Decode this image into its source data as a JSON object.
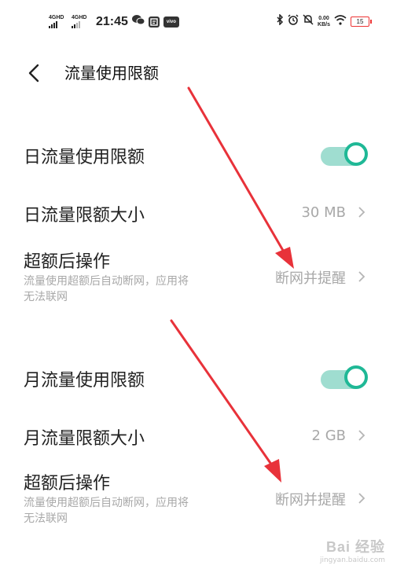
{
  "status_bar": {
    "net1": "4GHD",
    "net2": "4GHD",
    "time": "21:45",
    "app_icon_label": "vivo",
    "speed_value": "0.00",
    "speed_unit": "KB/s",
    "battery": "15"
  },
  "header": {
    "title": "流量使用限额"
  },
  "daily": {
    "limit_label": "日流量使用限额",
    "limit_enabled": true,
    "size_label": "日流量限额大小",
    "size_value": "30 MB",
    "action_label": "超额后操作",
    "action_desc": "流量使用超额后自动断网，应用将无法联网",
    "action_value": "断网并提醒"
  },
  "monthly": {
    "limit_label": "月流量使用限额",
    "limit_enabled": true,
    "size_label": "月流量限额大小",
    "size_value": "2 GB",
    "action_label": "超额后操作",
    "action_desc": "流量使用超额后自动断网，应用将无法联网",
    "action_value": "断网并提醒"
  },
  "watermark": {
    "main": "Bai 经验",
    "sub": "jingyan.baidu.com"
  },
  "colors": {
    "accent": "#1fb896",
    "toggle_track": "#9fddd0",
    "annotation_arrow": "#e8323a",
    "secondary_text": "#a8a8a8"
  }
}
